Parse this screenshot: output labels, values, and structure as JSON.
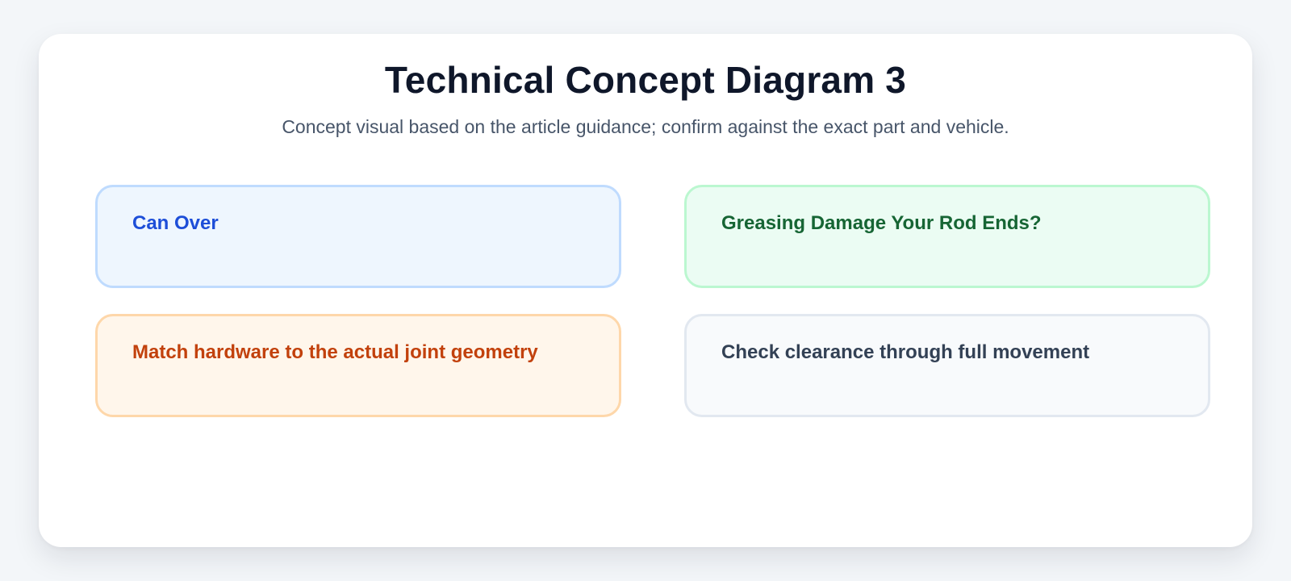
{
  "header": {
    "title": "Technical Concept Diagram 3",
    "subtitle": "Concept visual based on the article guidance; confirm against the exact part and vehicle."
  },
  "boxes": [
    {
      "label": "Can Over",
      "bg": "#eef6fe",
      "border": "#bfdbfe",
      "text": "#1d4ed8"
    },
    {
      "label": "Greasing Damage Your Rod Ends?",
      "bg": "#ebfcf3",
      "border": "#bbf7d0",
      "text": "#166534"
    },
    {
      "label": "Match hardware to the actual joint geometry",
      "bg": "#fff6eb",
      "border": "#fed7aa",
      "text": "#c2410c"
    },
    {
      "label": "Check clearance through full movement",
      "bg": "#f8fafc",
      "border": "#e2e8f0",
      "text": "#334155"
    }
  ]
}
